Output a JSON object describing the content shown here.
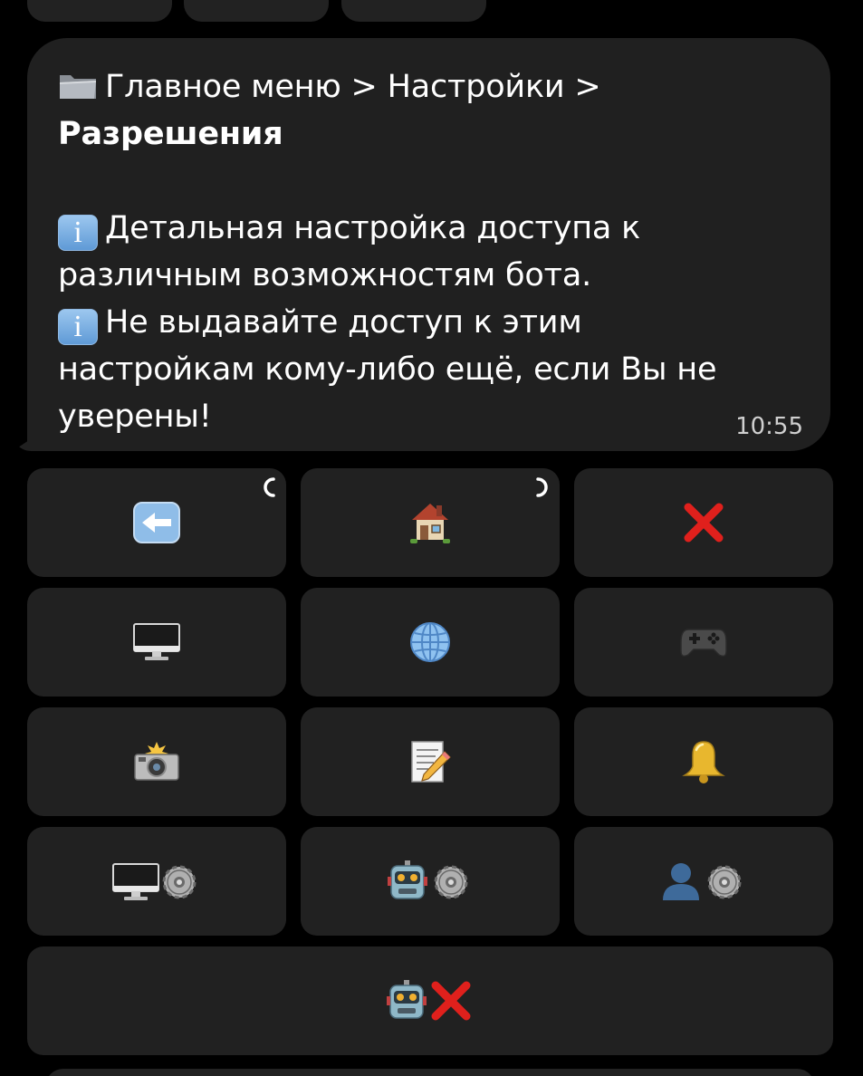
{
  "message": {
    "breadcrumb": "Главное меню > Настройки >",
    "current_section": "Разрешения",
    "info_line_1a": "Детальная настройка доступа к",
    "info_line_1b": "различным возможностям бота.",
    "info_line_2a": "Не выдавайте доступ к этим",
    "info_line_2b": "настройкам кому-либо ещё, если Вы не",
    "info_line_2c": "уверены!",
    "time": "10:55",
    "info_icon_glyph": "i"
  },
  "icons": {
    "breadcrumb": "folder-icon",
    "info": "info-icon"
  },
  "keyboard": {
    "rows": [
      [
        "back-arrow-icon",
        "house-icon",
        "cross-mark-icon"
      ],
      [
        "desktop-computer-icon",
        "globe-icon",
        "gamepad-icon"
      ],
      [
        "camera-flash-icon",
        "memo-icon",
        "bell-icon"
      ],
      [
        "desktop-settings-icon",
        "robot-settings-icon",
        "user-settings-icon"
      ],
      [
        "robot-remove-icon"
      ]
    ]
  },
  "colors": {
    "background": "#000000",
    "bubble": "#202020",
    "button": "#212121",
    "text": "#ffffff",
    "time": "#d0d0d0",
    "red_cross": "#e0201c",
    "info_blue": "#6fa6dc"
  }
}
